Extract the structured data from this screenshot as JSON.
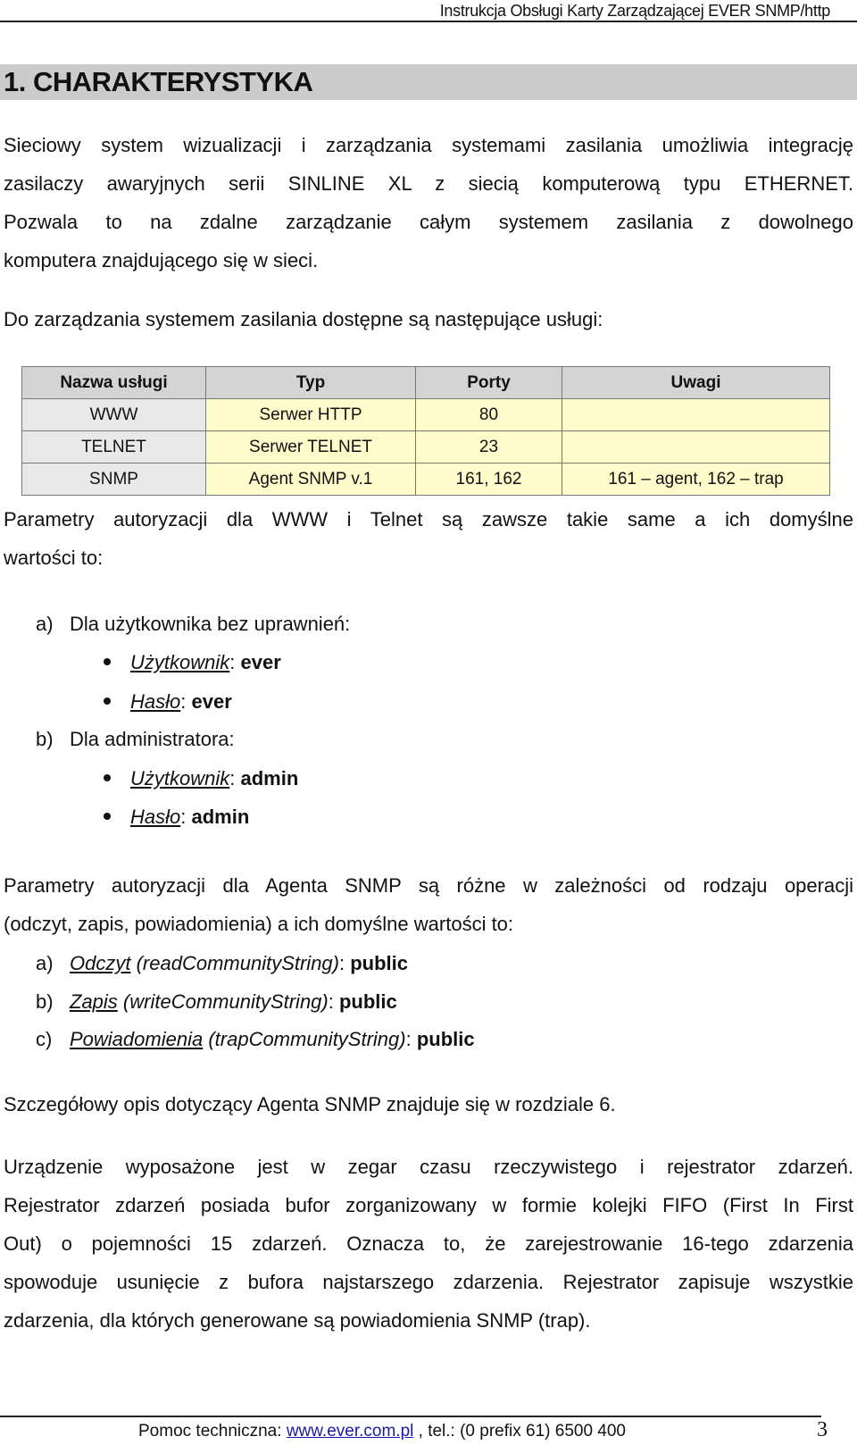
{
  "header": {
    "title": "Instrukcja Obsługi Karty Zarządzającej EVER SNMP/http"
  },
  "section": {
    "title": "1. CHARAKTERYSTYKA"
  },
  "intro": {
    "lines": [
      "Sieciowy system wizualizacji i zarządzania systemami zasilania umożliwia integrację",
      "zasilaczy awaryjnych serii SINLINE XL z siecią komputerową typu ETHERNET.",
      "Pozwala to na zdalne zarządzanie całym systemem zasilania z dowolnego",
      "komputera znajdującego się w sieci."
    ]
  },
  "services_intro": "Do zarządzania systemem zasilania dostępne są następujące usługi:",
  "table": {
    "headers": [
      "Nazwa usługi",
      "Typ",
      "Porty",
      "Uwagi"
    ],
    "rows": [
      [
        "WWW",
        "Serwer HTTP",
        "80",
        ""
      ],
      [
        "TELNET",
        "Serwer TELNET",
        "23",
        ""
      ],
      [
        "SNMP",
        "Agent SNMP v.1",
        "161, 162",
        "161 – agent, 162 – trap"
      ]
    ]
  },
  "auth_www": {
    "lines": [
      "Parametry autoryzacji dla WWW i Telnet są zawsze takie same a ich domyślne",
      "wartości to:"
    ],
    "groups": [
      {
        "marker": "a)",
        "label": "Dla użytkownika bez uprawnień:",
        "items": [
          {
            "key": "Użytkownik",
            "value": "ever"
          },
          {
            "key": "Hasło",
            "value": "ever"
          }
        ]
      },
      {
        "marker": "b)",
        "label": "Dla administratora:",
        "items": [
          {
            "key": "Użytkownik",
            "value": "admin"
          },
          {
            "key": "Hasło",
            "value": "admin"
          }
        ]
      }
    ]
  },
  "auth_snmp": {
    "lines": [
      "Parametry autoryzacji dla Agenta SNMP są różne w zależności od rodzaju operacji",
      "(odczyt, zapis, powiadomienia) a ich domyślne wartości to:"
    ],
    "items": [
      {
        "marker": "a)",
        "key": "Odczyt",
        "param": "(readCommunityString)",
        "value": "public"
      },
      {
        "marker": "b)",
        "key": "Zapis",
        "param": "(writeCommunityString)",
        "value": "public"
      },
      {
        "marker": "c)",
        "key": "Powiadomienia",
        "param": "(trapCommunityString)",
        "value": "public"
      }
    ]
  },
  "snmp_ref": "Szczegółowy opis dotyczący Agenta SNMP znajduje się w rozdziale 6.",
  "clock": {
    "lines": [
      "Urządzenie wyposażone jest w zegar czasu rzeczywistego i rejestrator zdarzeń.",
      "Rejestrator zdarzeń posiada bufor zorganizowany w formie kolejki FIFO (First In First",
      "Out) o pojemności 15 zdarzeń. Oznacza to, że zarejestrowanie 16-tego zdarzenia",
      "spowoduje usunięcie z bufora najstarszego zdarzenia. Rejestrator zapisuje wszystkie",
      "zdarzenia, dla których generowane są powiadomienia SNMP (trap)."
    ]
  },
  "footer": {
    "prefix": "Pomoc techniczna: ",
    "link": "www.ever.com.pl",
    "suffix": " , tel.: (0 prefix 61) 6500 400",
    "page": "3"
  }
}
